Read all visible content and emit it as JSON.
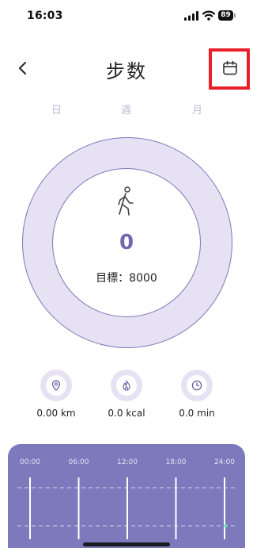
{
  "status_bar": {
    "time": "16:03",
    "battery": "89"
  },
  "header": {
    "title": "步数",
    "back_icon": "chevron-left-icon",
    "calendar_icon": "calendar-icon"
  },
  "tabs": [
    {
      "label": "日"
    },
    {
      "label": "週"
    },
    {
      "label": "月"
    }
  ],
  "summary": {
    "steps": "0",
    "goal_text": "目標：8000",
    "icon": "walking-person-icon",
    "progress": 0
  },
  "stats": [
    {
      "icon": "location-pin-icon",
      "label": "0.00 km"
    },
    {
      "icon": "flame-icon",
      "label": "0.0 kcal"
    },
    {
      "icon": "clock-icon",
      "label": "0.0 min"
    }
  ],
  "chart_data": {
    "type": "bar",
    "categories": [
      "00:00",
      "06:00",
      "12:00",
      "18:00",
      "24:00"
    ],
    "values": [
      0,
      0,
      0,
      0,
      0
    ],
    "xlabel": "",
    "ylabel": ""
  },
  "colors": {
    "accent": "#6f69b0",
    "ring_fill": "#e6e2f4",
    "chart_bg": "#7d79bd",
    "highlight": "#e8202a",
    "tab_inactive": "#bcbcd6"
  }
}
